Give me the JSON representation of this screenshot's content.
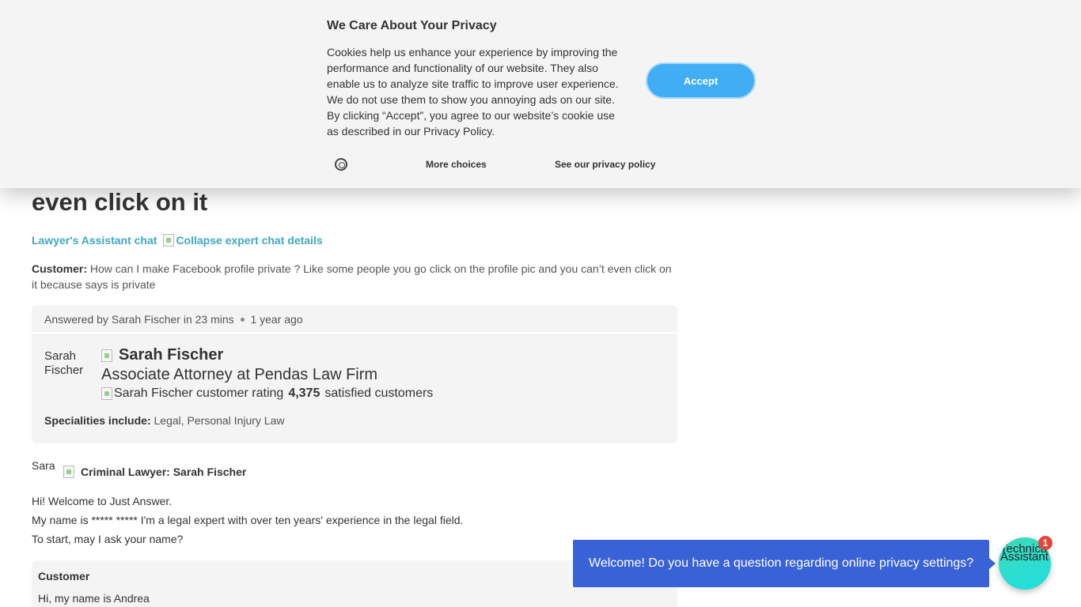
{
  "cookie_banner": {
    "title": "We Care About Your Privacy",
    "body": "Cookies help us enhance your experience by improving the performance and functionality of our website. They also enable us to analyze site traffic to improve user experience. We do not use them to show you annoying ads on our site. By clicking “Accept”, you agree to our website’s cookie use as described in our Privacy Policy.",
    "accept_label": "Accept",
    "more_choices_label": "More choices",
    "privacy_link_label": "See our privacy policy",
    "settings_icon": "gear-icon",
    "accent_color": "#41adf4"
  },
  "page": {
    "title_fragment": "even click on it",
    "chat_link": "Lawyer's Assistant chat",
    "collapse_alt": "Collapse expert chat details"
  },
  "question": {
    "label": "Customer:",
    "text": "How can I make Facebook profile private ? Like some people you go click on the profile pic and you can’t even click on it because says is private"
  },
  "answer": {
    "answered_by": "Answered by Sarah Fischer in 23 mins",
    "age": "1 year ago",
    "avatar_alt": "Sarah Fischer",
    "expert_name": "Sarah Fischer",
    "expert_title": "Associate Attorney at Pendas Law Firm",
    "rating_alt": "Sarah Fischer customer rating",
    "satisfied_count": "4,375",
    "satisfied_label": "satisfied customers",
    "specialties_label": "Specialities include:",
    "specialties": "Legal, Personal Injury Law"
  },
  "expert_message": {
    "avatar_alt": "Sara",
    "sender": "Criminal Lawyer: Sarah Fischer",
    "lines": [
      "Hi! Welcome to Just Answer.",
      "My name is ***** ***** I'm a legal expert with over ten years' experience in the legal field.",
      "To start, may I ask your name?"
    ]
  },
  "customer_message": {
    "sender": "Customer",
    "text": "Hi, my name is Andrea"
  },
  "chat_widget": {
    "bubble_text": "Welcome! Do you have a question regarding online privacy settings?",
    "assistant_alt": "Technical Assistant",
    "badge_count": "1",
    "bubble_color": "#3a62d7"
  }
}
